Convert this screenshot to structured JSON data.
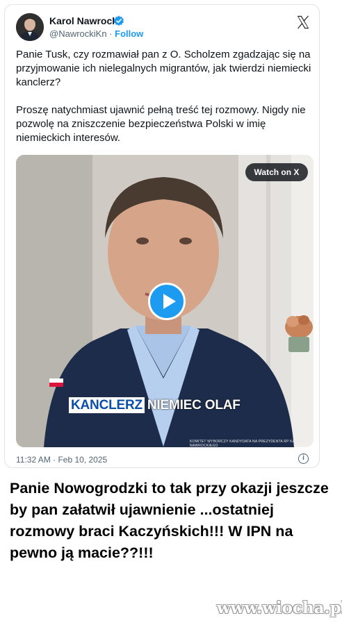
{
  "tweet": {
    "author_name": "Karol Nawrocki",
    "handle": "@NawrockiKn",
    "separator": " · ",
    "follow_label": "Follow",
    "text": "Panie Tusk, czy rozmawiał pan z O. Scholzem zgadzając się na przyjmowanie ich nielegalnych migrantów, jak twierdzi niemiecki kanclerz?\n\nProszę natychmiast ujawnić pełną treść tej rozmowy. Nigdy nie pozwolę na zniszczenie bezpieczeństwa Polski w imię niemieckich interesów.",
    "timestamp": "11:32 AM · Feb 10, 2025",
    "info_glyph": "i"
  },
  "video": {
    "watch_label": "Watch on X",
    "caption_highlight": "KANCLERZ",
    "caption_rest": "NIEMIEC OLAF",
    "credit_text": "KOMITET WYBORCZY KANDYDATA NA PREZYDENTA RP KAROLA NAWROCKIEGO"
  },
  "comment": {
    "text": "Panie Nowogrodzki to tak przy okazji jeszcze by pan załatwił ujawnienie ...ostatniej rozmowy braci Kaczyńskich!!! W IPN na pewno ją macie??!!!"
  },
  "watermark": {
    "text": "www.wiocha.pl"
  },
  "colors": {
    "accent": "#1d9bf0",
    "text": "#0f1419",
    "muted": "#536471"
  }
}
